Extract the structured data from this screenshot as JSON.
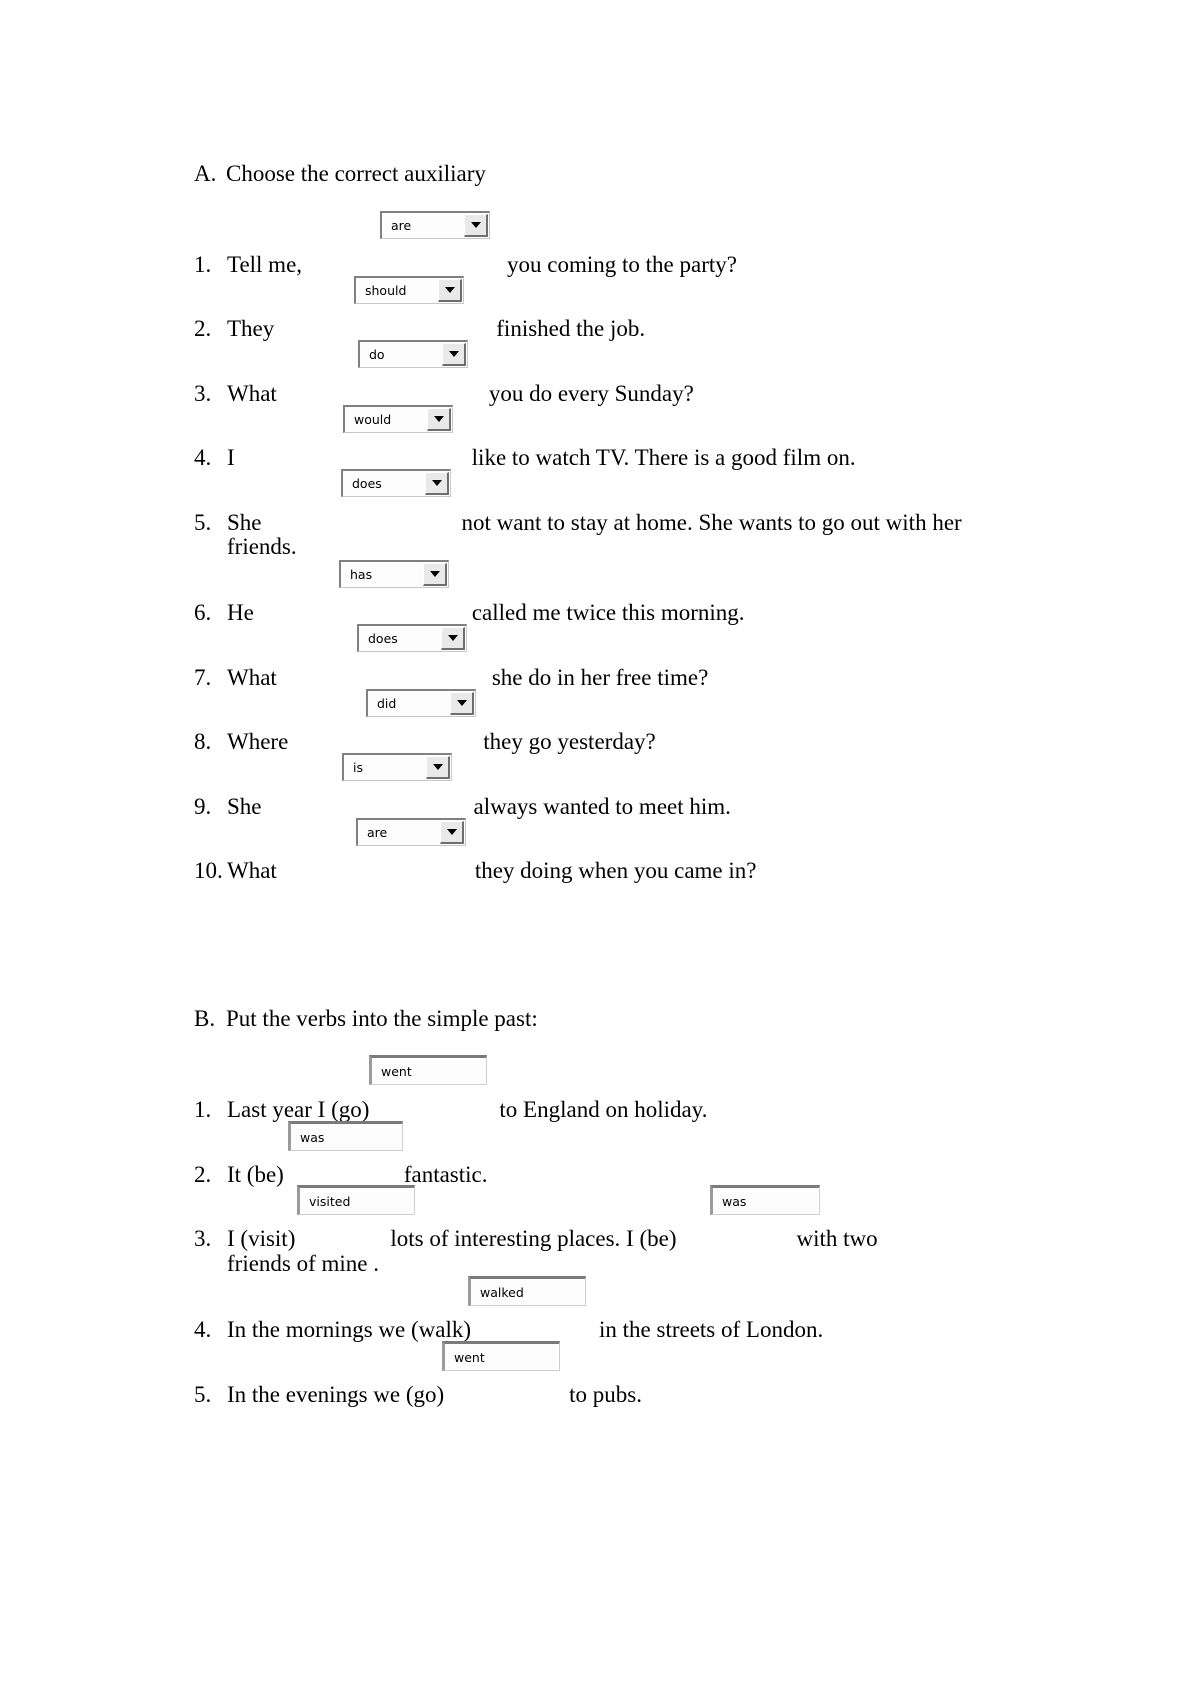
{
  "document": {
    "sections": [
      {
        "letter": "A.",
        "title": "Choose the correct auxiliary",
        "control_type": "dropdown",
        "items": [
          {
            "num": "1.",
            "before": "Tell me,",
            "after": "you coming to the party?",
            "value": "are",
            "line2": ""
          },
          {
            "num": "2.",
            "before": "They",
            "after": "finished the job.",
            "value": "should",
            "line2": ""
          },
          {
            "num": "3.",
            "before": "What",
            "after": "you do every Sunday?",
            "value": "do",
            "line2": ""
          },
          {
            "num": "4.",
            "before": "I",
            "after": "like to watch TV. There is a good film on.",
            "value": "would",
            "line2": ""
          },
          {
            "num": "5.",
            "before": "She",
            "after": "not want to stay at home. She wants to go out with her",
            "value": "does",
            "line2": "friends."
          },
          {
            "num": "6.",
            "before": "He",
            "after": "called me twice this morning.",
            "value": "has",
            "line2": ""
          },
          {
            "num": "7.",
            "before": "What",
            "after": "she do in her free time?",
            "value": "does",
            "line2": ""
          },
          {
            "num": "8.",
            "before": "Where",
            "after": "they go yesterday?",
            "value": "did",
            "line2": ""
          },
          {
            "num": "9.",
            "before": "She",
            "after": "always wanted to meet him.",
            "value": "is",
            "line2": ""
          },
          {
            "num": "10.",
            "before": "What",
            "after": "they doing when you came in?",
            "value": "are",
            "line2": ""
          }
        ]
      },
      {
        "letter": "B.",
        "title": "Put the verbs into the simple past:",
        "control_type": "text",
        "items": [
          {
            "num": "1.",
            "before": "Last year I (go)",
            "after": "to England on holiday.",
            "value": "went",
            "line2": ""
          },
          {
            "num": "2.",
            "before": "It (be)",
            "after": "fantastic.",
            "value": "was",
            "line2": ""
          },
          {
            "num": "3.",
            "before": "I (visit)",
            "middle": "lots of interesting places. I (be)",
            "after": "with two",
            "value": "visited",
            "value2": "was",
            "line2": "friends of mine ."
          },
          {
            "num": "4.",
            "before": "In the mornings we (walk)",
            "after": "in the streets of London.",
            "value": "walked",
            "line2": ""
          },
          {
            "num": "5.",
            "before": "In the evenings we (go)",
            "after": "to pubs.",
            "value": "went",
            "line2": ""
          }
        ]
      }
    ],
    "icons": {
      "dropdown_arrow": "chevron-down-icon"
    }
  }
}
